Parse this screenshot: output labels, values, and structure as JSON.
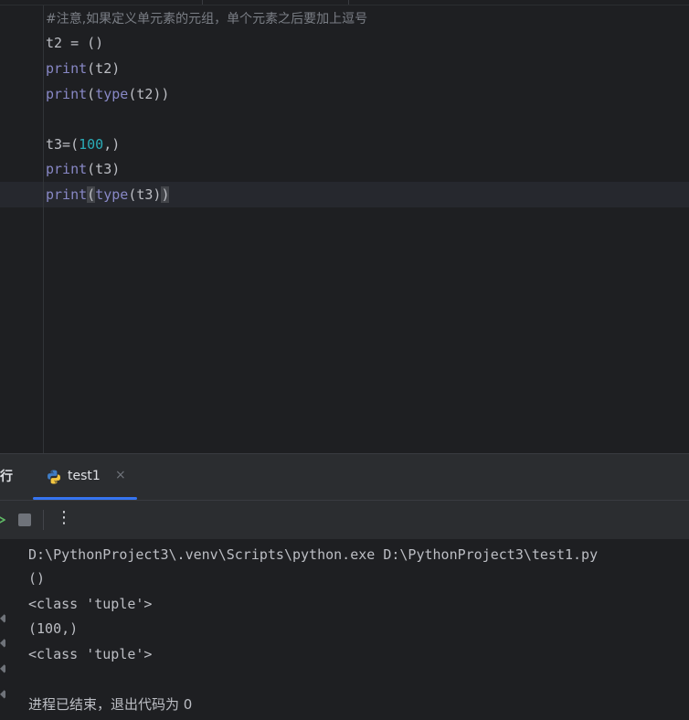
{
  "editor": {
    "lines": [
      {
        "id": "l1",
        "segments": [
          {
            "cls": "comment",
            "text": "#注意,如果定义单元素的元组，单个元素之后要加上逗号"
          }
        ]
      },
      {
        "id": "l2",
        "segments": [
          {
            "cls": "",
            "text": "t2 = ()"
          }
        ]
      },
      {
        "id": "l3",
        "segments": [
          {
            "cls": "builtin",
            "text": "print"
          },
          {
            "cls": "",
            "text": "(t2)"
          }
        ]
      },
      {
        "id": "l4",
        "segments": [
          {
            "cls": "builtin",
            "text": "print"
          },
          {
            "cls": "",
            "text": "("
          },
          {
            "cls": "builtin",
            "text": "type"
          },
          {
            "cls": "",
            "text": "(t2))"
          }
        ]
      },
      {
        "id": "l5",
        "segments": [
          {
            "cls": "",
            "text": ""
          }
        ]
      },
      {
        "id": "l6",
        "segments": [
          {
            "cls": "",
            "text": "t3=("
          },
          {
            "cls": "num",
            "text": "100"
          },
          {
            "cls": "",
            "text": ",)"
          }
        ]
      },
      {
        "id": "l7",
        "segments": [
          {
            "cls": "builtin",
            "text": "print"
          },
          {
            "cls": "",
            "text": "(t3)"
          }
        ]
      },
      {
        "id": "l8",
        "segments": [
          {
            "cls": "builtin",
            "text": "print"
          },
          {
            "cls": "paren-hl",
            "text": "("
          },
          {
            "cls": "builtin",
            "text": "type"
          },
          {
            "cls": "",
            "text": "(t3)"
          },
          {
            "cls": "paren-hl",
            "text": ")"
          }
        ]
      }
    ]
  },
  "run_panel": {
    "title": "行",
    "tab_label": "test1",
    "tab_close": "×",
    "more": "⋮"
  },
  "console": {
    "command": "D:\\PythonProject3\\.venv\\Scripts\\python.exe D:\\PythonProject3\\test1.py",
    "out1": "()",
    "out2": "<class 'tuple'>",
    "out3": "(100,)",
    "out4": "<class 'tuple'>",
    "exit_msg": "进程已结束，退出代码为 0"
  },
  "colors": {
    "accent": "#3574f0",
    "builtin": "#8888c6",
    "number": "#2aacb8",
    "comment": "#7a7e85",
    "run_green": "#5fb865"
  },
  "icons": {
    "tab": "python-icon",
    "rerun": "rerun-icon",
    "stop": "stop-icon",
    "more": "more-vertical-icon",
    "close": "close-icon"
  }
}
